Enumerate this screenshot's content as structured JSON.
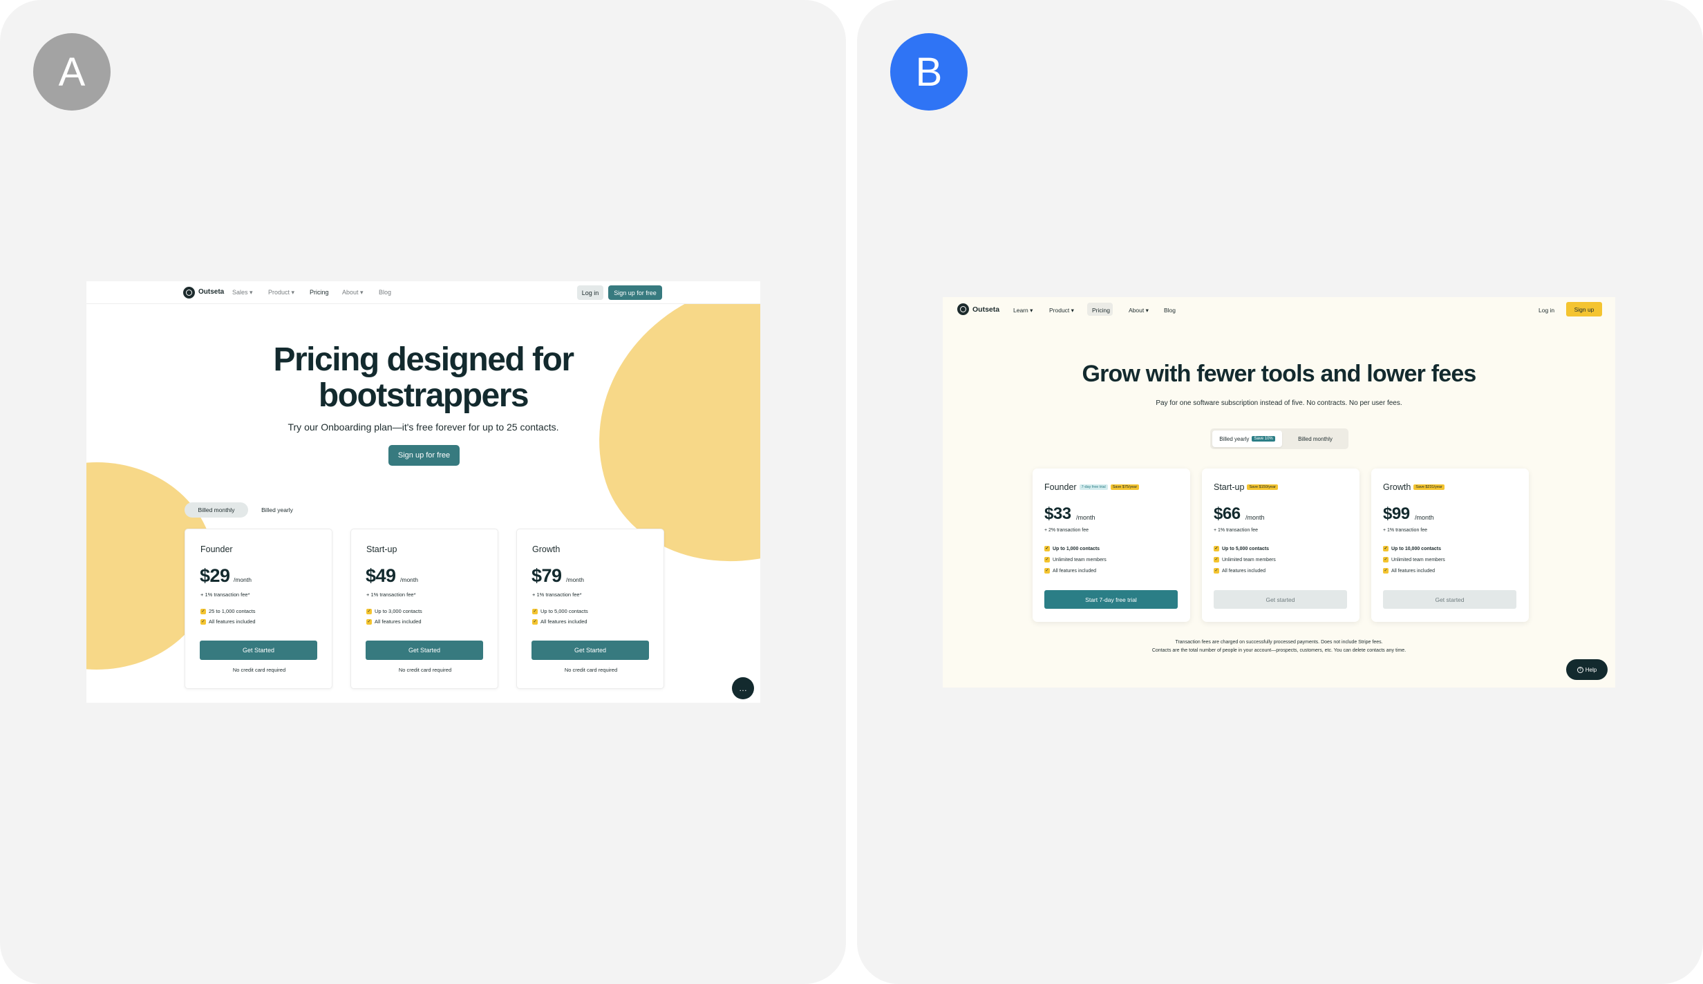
{
  "panels": {
    "a": {
      "badge": "A",
      "brand": "Outseta",
      "nav": [
        "Sales ▾",
        "Product ▾",
        "Pricing",
        "About ▾",
        "Blog"
      ],
      "login": "Log in",
      "signup": "Sign up for free",
      "hero_title": "Pricing designed for bootstrappers",
      "hero_subtitle": "Try our Onboarding plan—it's free forever for up to 25 contacts.",
      "hero_cta": "Sign up for free",
      "toggle": {
        "monthly": "Billed monthly",
        "yearly": "Billed yearly",
        "selected": "monthly"
      },
      "plans": [
        {
          "name": "Founder",
          "price": "$29",
          "period": "/month",
          "fee": "+ 1% transaction fee*",
          "features": [
            "25 to 1,000 contacts",
            "All features included"
          ],
          "cta": "Get Started",
          "note": "No credit card required"
        },
        {
          "name": "Start-up",
          "price": "$49",
          "period": "/month",
          "fee": "+ 1% transaction fee*",
          "features": [
            "Up to 3,000 contacts",
            "All features included"
          ],
          "cta": "Get Started",
          "note": "No credit card required"
        },
        {
          "name": "Growth",
          "price": "$79",
          "period": "/month",
          "fee": "+ 1% transaction fee*",
          "features": [
            "Up to 5,000 contacts",
            "All features included"
          ],
          "cta": "Get Started",
          "note": "No credit card required"
        }
      ],
      "chat_icon": "…",
      "colors": {
        "accent": "#377a7f",
        "blob": "#f7d888",
        "badge": "#a3a3a3"
      }
    },
    "b": {
      "badge": "B",
      "brand": "Outseta",
      "nav": [
        "Learn ▾",
        "Product ▾",
        "Pricing",
        "About ▾",
        "Blog"
      ],
      "login": "Log in",
      "signup": "Sign up",
      "hero_title": "Grow with fewer tools and lower fees",
      "hero_subtitle": "Pay for one software subscription instead of five. No contracts. No per user fees.",
      "toggle": {
        "yearly": "Billed yearly",
        "yearly_tag": "Save 10%",
        "monthly": "Billed monthly",
        "selected": "yearly"
      },
      "plans": [
        {
          "name": "Founder",
          "tags": [
            "7-day free trial",
            "Save $75/year"
          ],
          "price": "$33",
          "period": "/month",
          "fee": "+ 2% transaction fee",
          "features": [
            "Up to 1,000 contacts",
            "Unlimited team members",
            "All features included"
          ],
          "cta": "Start 7-day free trial",
          "cta_style": "primary"
        },
        {
          "name": "Start-up",
          "tags": [
            "Save $150/year"
          ],
          "price": "$66",
          "period": "/month",
          "fee": "+ 1% transaction fee",
          "features": [
            "Up to 5,000 contacts",
            "Unlimited team members",
            "All features included"
          ],
          "cta": "Get started",
          "cta_style": "secondary"
        },
        {
          "name": "Growth",
          "tags": [
            "Save $231/year"
          ],
          "price": "$99",
          "period": "/month",
          "fee": "+ 1% transaction fee",
          "features": [
            "Up to 10,000 contacts",
            "Unlimited team members",
            "All features included"
          ],
          "cta": "Get started",
          "cta_style": "secondary"
        }
      ],
      "footnotes": [
        "Transaction fees are charged on successfully processed payments. Does not include Stripe fees.",
        "Contacts are the total number of people in your account—prospects, customers, etc. You can delete contacts any time."
      ],
      "help_icon": "?",
      "help": "Help",
      "colors": {
        "accent": "#2b7e86",
        "signup": "#f4c430",
        "badge": "#2f74f5"
      }
    }
  }
}
